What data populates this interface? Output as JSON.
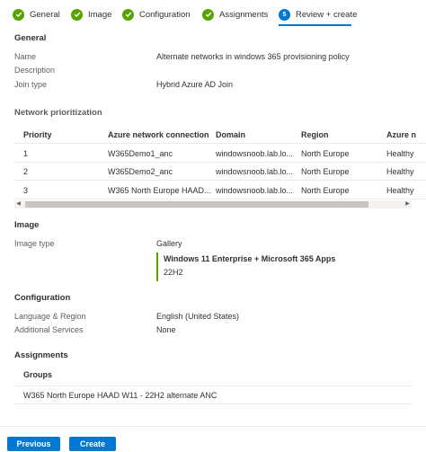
{
  "wizard": {
    "steps": [
      {
        "label": "General",
        "state": "complete"
      },
      {
        "label": "Image",
        "state": "complete"
      },
      {
        "label": "Configuration",
        "state": "complete"
      },
      {
        "label": "Assignments",
        "state": "complete"
      },
      {
        "label": "Review + create",
        "state": "active",
        "number": "5"
      }
    ]
  },
  "general": {
    "title": "General",
    "fields": [
      {
        "label": "Name",
        "value": "Alternate networks in windows 365 provisioning policy"
      },
      {
        "label": "Description",
        "value": ""
      },
      {
        "label": "Join type",
        "value": "Hybrid Azure AD Join"
      }
    ]
  },
  "network": {
    "title": "Network prioritization",
    "columns": [
      "Priority",
      "Azure network connection",
      "Domain",
      "Region",
      "Azure n"
    ],
    "rows": [
      [
        "1",
        "W365Demo1_anc",
        "windowsnoob.lab.lo...",
        "North Europe",
        "Healthy"
      ],
      [
        "2",
        "W365Demo2_anc",
        "windowsnoob.lab.lo...",
        "North Europe",
        "Healthy"
      ],
      [
        "3",
        "W365 North Europe HAAD...",
        "windowsnoob.lab.lo...",
        "North Europe",
        "Healthy"
      ]
    ]
  },
  "image": {
    "title": "Image",
    "type_label": "Image type",
    "type_value": "Gallery",
    "image_name": "Windows 11 Enterprise + Microsoft 365 Apps",
    "image_version": "22H2"
  },
  "configuration": {
    "title": "Configuration",
    "fields": [
      {
        "label": "Language & Region",
        "value": "English (United States)"
      },
      {
        "label": "Additional Services",
        "value": "None"
      }
    ]
  },
  "assignments": {
    "title": "Assignments",
    "groups_header": "Groups",
    "groups": [
      "W365 North Europe HAAD W11 - 22H2 alternate ANC"
    ]
  },
  "footer": {
    "previous_label": "Previous",
    "create_label": "Create"
  },
  "colors": {
    "accent": "#0078d4",
    "success": "#57a300",
    "border": "#edebe9"
  }
}
